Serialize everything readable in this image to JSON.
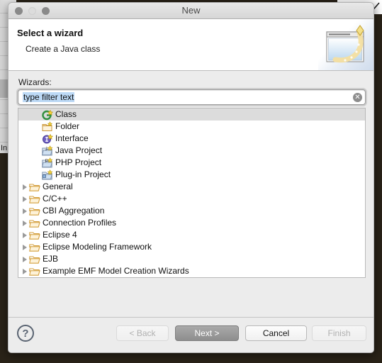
{
  "window": {
    "title": "New",
    "traffic_lights": [
      "close-light",
      "minimize-light",
      "zoom-light"
    ]
  },
  "header": {
    "title": "Select a wizard",
    "subtitle": "Create a Java class",
    "banner_icon": "new-wizard-banner-icon"
  },
  "filter": {
    "label": "Wizards:",
    "value": "type filter text",
    "placeholder": "type filter text",
    "clear_icon": "clear-icon",
    "clear_glyph": "✕"
  },
  "tree": {
    "items": [
      {
        "label": "Class",
        "icon": "java-class-icon",
        "expandable": false,
        "selected": true
      },
      {
        "label": "Folder",
        "icon": "folder-new-icon",
        "expandable": false,
        "selected": false
      },
      {
        "label": "Interface",
        "icon": "java-interface-icon",
        "expandable": false,
        "selected": false
      },
      {
        "label": "Java Project",
        "icon": "java-project-icon",
        "expandable": false,
        "selected": false
      },
      {
        "label": "PHP Project",
        "icon": "php-project-icon",
        "expandable": false,
        "selected": false
      },
      {
        "label": "Plug-in Project",
        "icon": "plugin-project-icon",
        "expandable": false,
        "selected": false
      },
      {
        "label": "General",
        "icon": "folder-icon",
        "expandable": true,
        "selected": false
      },
      {
        "label": "C/C++",
        "icon": "folder-icon",
        "expandable": true,
        "selected": false
      },
      {
        "label": "CBI Aggregation",
        "icon": "folder-icon",
        "expandable": true,
        "selected": false
      },
      {
        "label": "Connection Profiles",
        "icon": "folder-icon",
        "expandable": true,
        "selected": false
      },
      {
        "label": "Eclipse 4",
        "icon": "folder-icon",
        "expandable": true,
        "selected": false
      },
      {
        "label": "Eclipse Modeling Framework",
        "icon": "folder-icon",
        "expandable": true,
        "selected": false
      },
      {
        "label": "EJB",
        "icon": "folder-icon",
        "expandable": true,
        "selected": false
      },
      {
        "label": "Example EMF Model Creation Wizards",
        "icon": "folder-icon",
        "expandable": true,
        "selected": false
      }
    ]
  },
  "footer": {
    "help_label": "?",
    "help_icon": "help-icon",
    "buttons": [
      {
        "label": "< Back",
        "state": "disabled"
      },
      {
        "label": "Next >",
        "state": "default"
      },
      {
        "label": "Cancel",
        "state": "normal"
      },
      {
        "label": "Finish",
        "state": "disabled"
      }
    ]
  },
  "background": {
    "partial_label": "In"
  },
  "colors": {
    "dialog_bg": "#ececec",
    "selection_highlight": "#dcdcdc",
    "text_selection": "#bcd9f5",
    "default_button": "#8e8e8e",
    "folder_icon": "#e8a33d",
    "desktop": "#2a2318"
  }
}
